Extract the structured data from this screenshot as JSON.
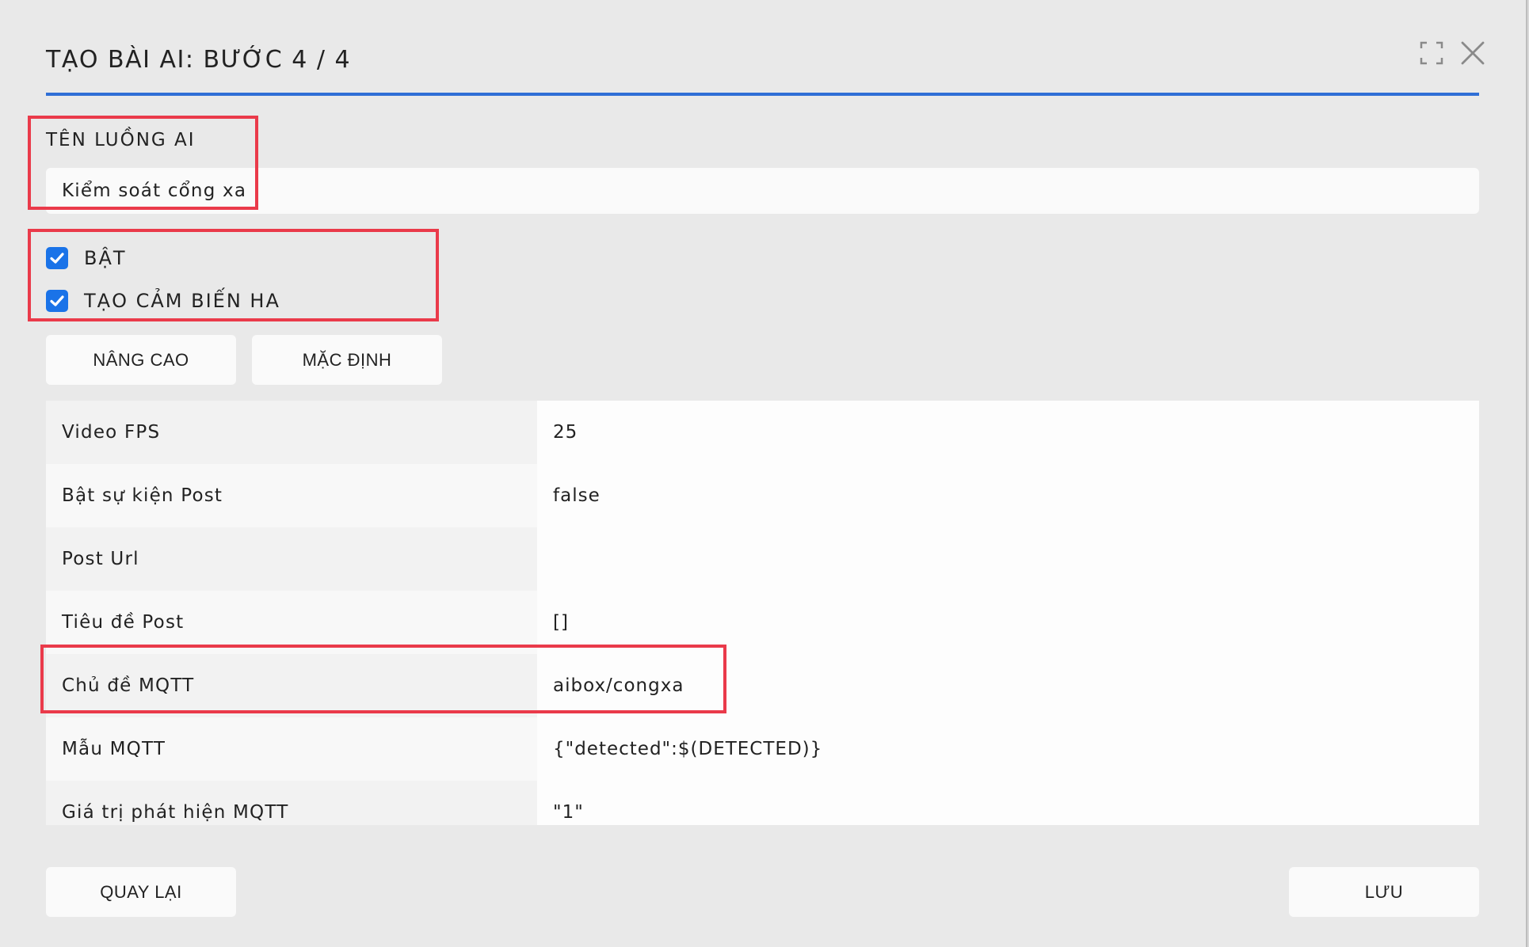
{
  "dialog": {
    "title": "TẠO BÀI AI: BƯỚC 4 / 4"
  },
  "icons": {
    "maximize": "maximize-icon",
    "close": "close-icon",
    "check": "checkmark-icon"
  },
  "colors": {
    "accent": "#2f6fd6",
    "checkbox": "#1a73e8",
    "highlight": "#ea3a4a"
  },
  "name_field": {
    "label": "TÊN LUỒNG AI",
    "value": "Kiểm soát cổng xa"
  },
  "checkboxes": [
    {
      "label": "BẬT",
      "checked": true
    },
    {
      "label": "TẠO CẢM BIẾN HA",
      "checked": true
    }
  ],
  "buttons": {
    "advanced": "NÂNG CAO",
    "default": "MẶC ĐỊNH",
    "back": "QUAY LẠI",
    "save": "LƯU"
  },
  "properties": [
    {
      "key": "Video FPS",
      "value": "25"
    },
    {
      "key": "Bật sự kiện Post",
      "value": "false"
    },
    {
      "key": "Post Url",
      "value": ""
    },
    {
      "key": "Tiêu đề Post",
      "value": "[]"
    },
    {
      "key": "Chủ đề MQTT",
      "value": "aibox/congxa"
    },
    {
      "key": "Mẫu MQTT",
      "value": "{\"detected\":$(DETECTED)}"
    },
    {
      "key": "Giá trị phát hiện MQTT",
      "value": "\"1\""
    }
  ]
}
